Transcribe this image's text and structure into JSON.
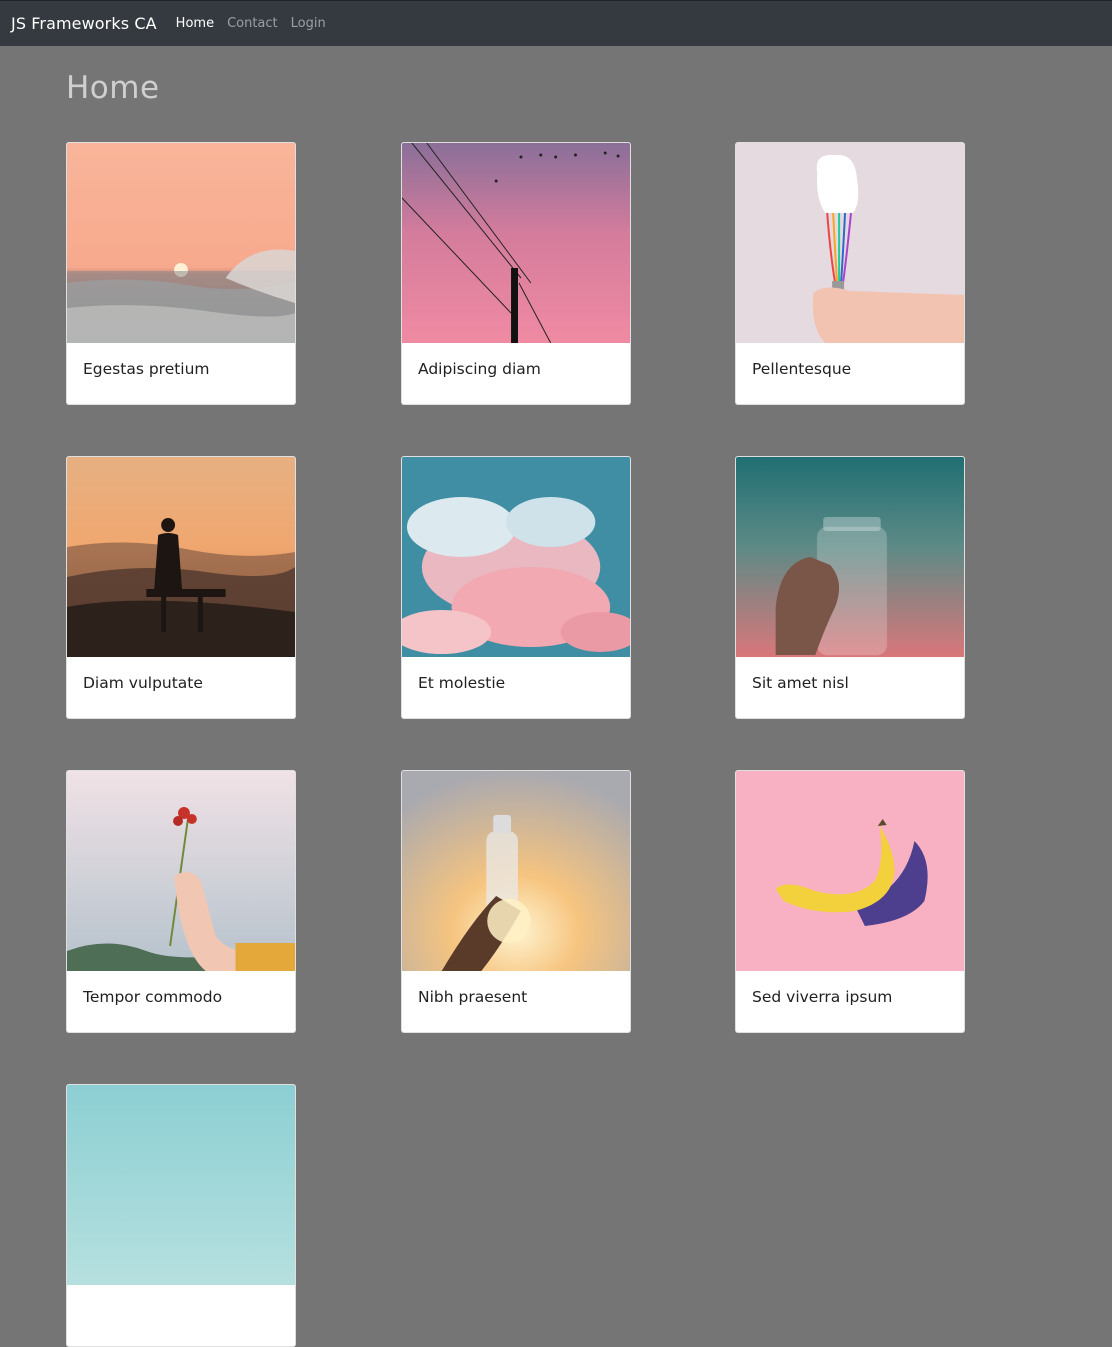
{
  "navbar": {
    "brand": "JS Frameworks CA",
    "links": [
      {
        "label": "Home",
        "active": true
      },
      {
        "label": "Contact",
        "active": false
      },
      {
        "label": "Login",
        "active": false
      }
    ]
  },
  "page": {
    "title": "Home"
  },
  "cards": [
    {
      "title": "Egestas pretium",
      "image": "sunset-ocean-wave"
    },
    {
      "title": "Adipiscing diam",
      "image": "power-lines-pink-sky"
    },
    {
      "title": "Pellentesque",
      "image": "hand-holding-whisk-cream"
    },
    {
      "title": "Diam vulputate",
      "image": "woman-on-bench-sunset-hills"
    },
    {
      "title": "Et molestie",
      "image": "pink-clouds-blue-sky"
    },
    {
      "title": "Sit amet nisl",
      "image": "hand-holding-glass-jar"
    },
    {
      "title": "Tempor commodo",
      "image": "hand-holding-red-flower"
    },
    {
      "title": "Nibh praesent",
      "image": "hand-holding-water-bottle-sun"
    },
    {
      "title": "Sed viverra ipsum",
      "image": "banana-on-pink"
    },
    {
      "title": "",
      "image": "teal-sky-partial"
    }
  ]
}
